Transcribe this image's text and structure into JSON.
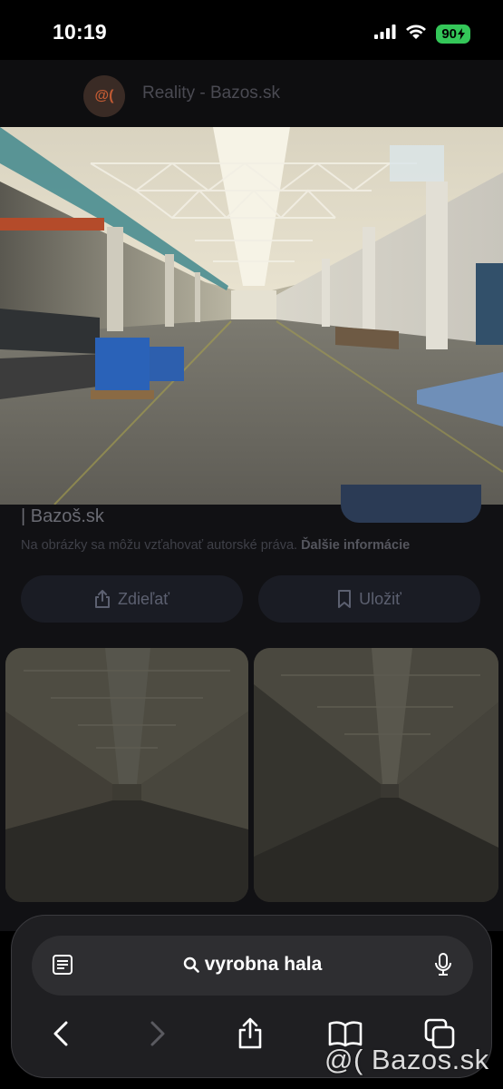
{
  "status_bar": {
    "time": "10:19",
    "battery_level": "90",
    "battery_color": "#34c759"
  },
  "site_header": {
    "favicon_text": "@(",
    "title": "Reality - Bazos.sk"
  },
  "result": {
    "source": "| Bazoš.sk",
    "copyright_text": "Na obrázky sa môžu vzťahovať autorské práva.",
    "more_info_link": "Ďalšie informácie",
    "share_label": "Zdieľať",
    "save_label": "Uložiť"
  },
  "toolbar": {
    "address_text": "vyrobna hala",
    "icons": [
      "reader-icon",
      "search-icon",
      "microphone-icon",
      "back-icon",
      "forward-icon",
      "share-icon",
      "bookmarks-icon",
      "tabs-icon"
    ]
  },
  "watermark": {
    "text": "@( Bazos.sk"
  },
  "colors": {
    "accent": "#34c759",
    "favicon": "#c05a33"
  }
}
